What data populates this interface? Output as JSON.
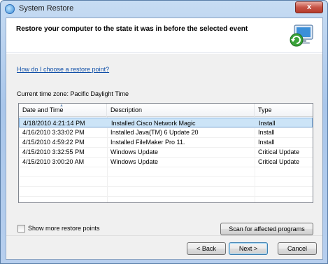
{
  "window": {
    "title": "System Restore",
    "close_glyph": "x",
    "icon": "system-restore-icon"
  },
  "header": {
    "title": "Restore your computer to the state it was in before the selected event",
    "icon": "restore-monitor-icon"
  },
  "help_link": "How do I choose a restore point?",
  "timezone_label": "Current time zone: Pacific Daylight Time",
  "table": {
    "columns": [
      "Date and Time",
      "Description",
      "Type"
    ],
    "rows": [
      {
        "date": "4/18/2010 4:21:14 PM",
        "description": "Installed Cisco Network Magic",
        "type": "Install",
        "selected": true
      },
      {
        "date": "4/16/2010 3:33:02 PM",
        "description": "Installed Java(TM) 6 Update 20",
        "type": "Install",
        "selected": false
      },
      {
        "date": "4/15/2010 4:59:22 PM",
        "description": "Installed FileMaker Pro 11.",
        "type": "Install",
        "selected": false
      },
      {
        "date": "4/15/2010 3:32:55 PM",
        "description": "Windows Update",
        "type": "Critical Update",
        "selected": false
      },
      {
        "date": "4/15/2010 3:00:20 AM",
        "description": "Windows Update",
        "type": "Critical Update",
        "selected": false
      }
    ]
  },
  "show_more": {
    "label": "Show more restore points",
    "checked": false
  },
  "buttons": {
    "scan": "Scan for affected programs",
    "back": "< Back",
    "next": "Next >",
    "cancel": "Cancel"
  },
  "colors": {
    "selection": "#cce4f7",
    "link": "#0f4fa8",
    "close": "#c75446"
  }
}
